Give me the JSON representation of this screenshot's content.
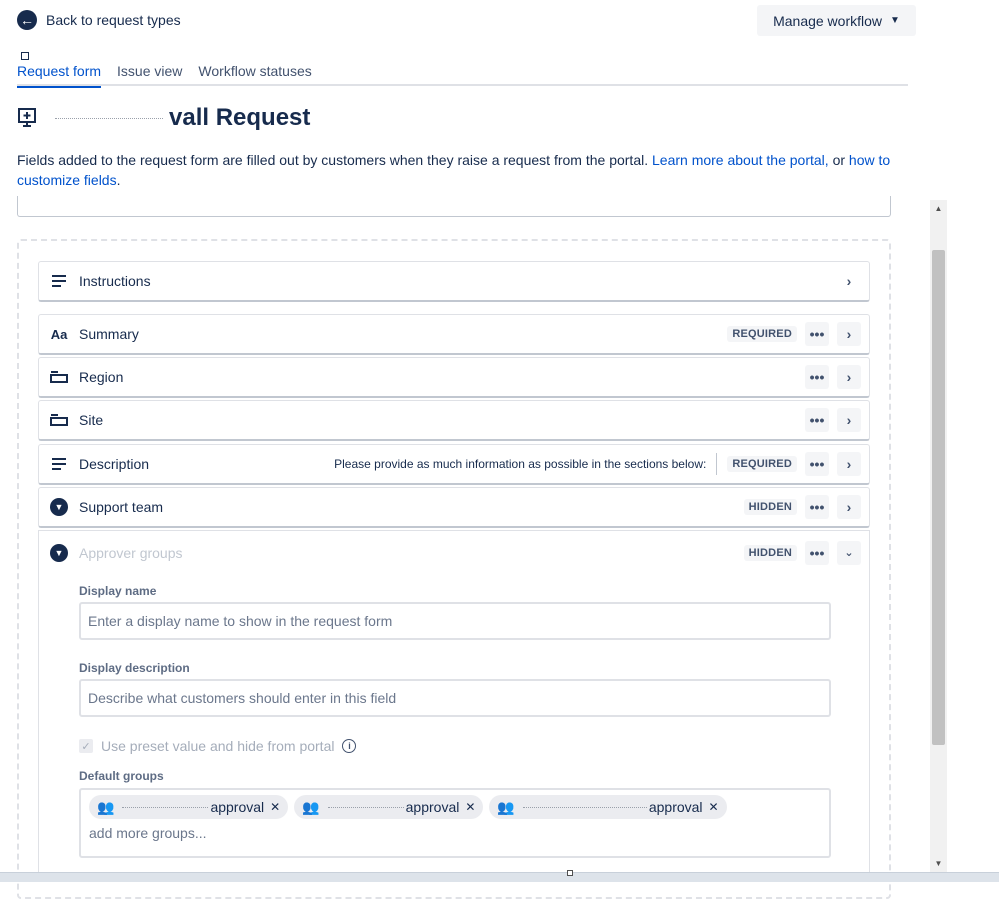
{
  "back_link": {
    "label": "Back to request types"
  },
  "manage_workflow": {
    "label": "Manage workflow"
  },
  "tabs": [
    {
      "label": "Request form",
      "active": true
    },
    {
      "label": "Issue view",
      "active": false
    },
    {
      "label": "Workflow statuses",
      "active": false
    }
  ],
  "page_title": "vall Request",
  "description": {
    "text": "Fields added to the request form are filled out by customers when they raise a request from the portal.",
    "link1": "Learn more about the portal,",
    "or": "or",
    "link2": "how to customize fields",
    "period": "."
  },
  "fields": [
    {
      "label": "Instructions",
      "icon": "lines-icon"
    },
    {
      "label": "Summary",
      "icon": "text-aa-icon",
      "badge": "REQUIRED"
    },
    {
      "label": "Region",
      "icon": "select-field-icon"
    },
    {
      "label": "Site",
      "icon": "select-field-icon"
    },
    {
      "label": "Description",
      "icon": "lines-icon",
      "hint": "Please provide as much information as possible in the sections below:",
      "badge": "REQUIRED"
    },
    {
      "label": "Support team",
      "icon": "dropdown-circle-icon",
      "badge": "HIDDEN"
    },
    {
      "label": "Approver groups",
      "icon": "dropdown-circle-icon",
      "badge": "HIDDEN"
    }
  ],
  "more_glyph": "•••",
  "expanded_panel": {
    "display_name_label": "Display name",
    "display_name_placeholder": "Enter a display name to show in the request form",
    "display_description_label": "Display description",
    "display_description_placeholder": "Describe what customers should enter in this field",
    "preset_checkbox_label": "Use preset value and hide from portal",
    "default_groups_label": "Default groups",
    "groups": [
      {
        "visible_text": "approval"
      },
      {
        "visible_text": "approval"
      },
      {
        "visible_text": "approval"
      }
    ],
    "add_more_placeholder": "add more groups..."
  },
  "colors": {
    "accent": "#0052cc",
    "text": "#172b4d",
    "muted": "#6b778c",
    "border": "#dfe1e6"
  }
}
